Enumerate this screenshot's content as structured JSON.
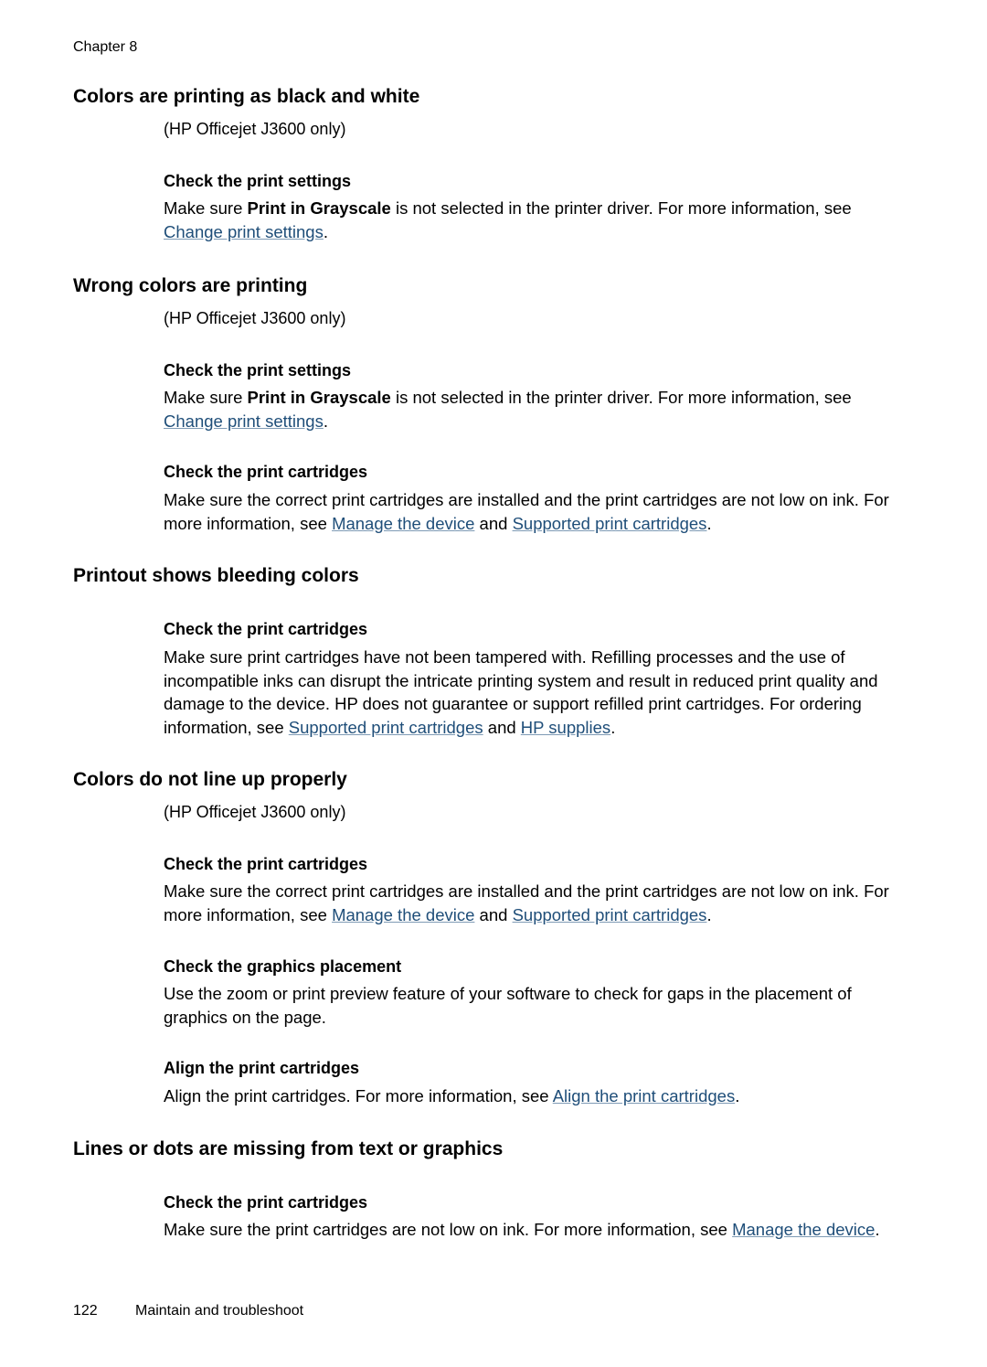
{
  "header": {
    "chapter": "Chapter 8"
  },
  "sections": [
    {
      "title": "Colors are printing as black and white",
      "note": "(HP Officejet J3600 only)",
      "subsections": [
        {
          "title": "Check the print settings",
          "text_before": "Make sure ",
          "bold": "Print in Grayscale",
          "text_after": " is not selected in the printer driver. For more information, see ",
          "link1": "Change print settings",
          "end": "."
        }
      ]
    },
    {
      "title": "Wrong colors are printing",
      "note": "(HP Officejet J3600 only)",
      "subsections": [
        {
          "title": "Check the print settings",
          "text_before": "Make sure ",
          "bold": "Print in Grayscale",
          "text_after": " is not selected in the printer driver. For more information, see ",
          "link1": "Change print settings",
          "end": "."
        },
        {
          "title": "Check the print cartridges",
          "text_before": "Make sure the correct print cartridges are installed and the print cartridges are not low on ink. For more information, see ",
          "link1": "Manage the device",
          "middle": " and ",
          "link2": "Supported print cartridges",
          "end": "."
        }
      ]
    },
    {
      "title": "Printout shows bleeding colors",
      "subsections": [
        {
          "title": "Check the print cartridges",
          "text_before": "Make sure print cartridges have not been tampered with. Refilling processes and the use of incompatible inks can disrupt the intricate printing system and result in reduced print quality and damage to the device. HP does not guarantee or support refilled print cartridges. For ordering information, see ",
          "link1": "Supported print cartridges",
          "middle": " and ",
          "link2": "HP supplies",
          "end": "."
        }
      ]
    },
    {
      "title": "Colors do not line up properly",
      "note": "(HP Officejet J3600 only)",
      "subsections": [
        {
          "title": "Check the print cartridges",
          "text_before": "Make sure the correct print cartridges are installed and the print cartridges are not low on ink. For more information, see ",
          "link1": "Manage the device",
          "middle": " and ",
          "link2": "Supported print cartridges",
          "end": "."
        },
        {
          "title": "Check the graphics placement",
          "text_before": "Use the zoom or print preview feature of your software to check for gaps in the placement of graphics on the page."
        },
        {
          "title": "Align the print cartridges",
          "text_before": "Align the print cartridges. For more information, see ",
          "link1": "Align the print cartridges",
          "end": "."
        }
      ]
    },
    {
      "title": "Lines or dots are missing from text or graphics",
      "subsections": [
        {
          "title": "Check the print cartridges",
          "text_before": "Make sure the print cartridges are not low on ink. For more information, see ",
          "link1": "Manage the device",
          "end": "."
        }
      ]
    }
  ],
  "footer": {
    "page_number": "122",
    "section": "Maintain and troubleshoot"
  },
  "colors": {
    "link": "#1f4e79",
    "text": "#000000"
  }
}
